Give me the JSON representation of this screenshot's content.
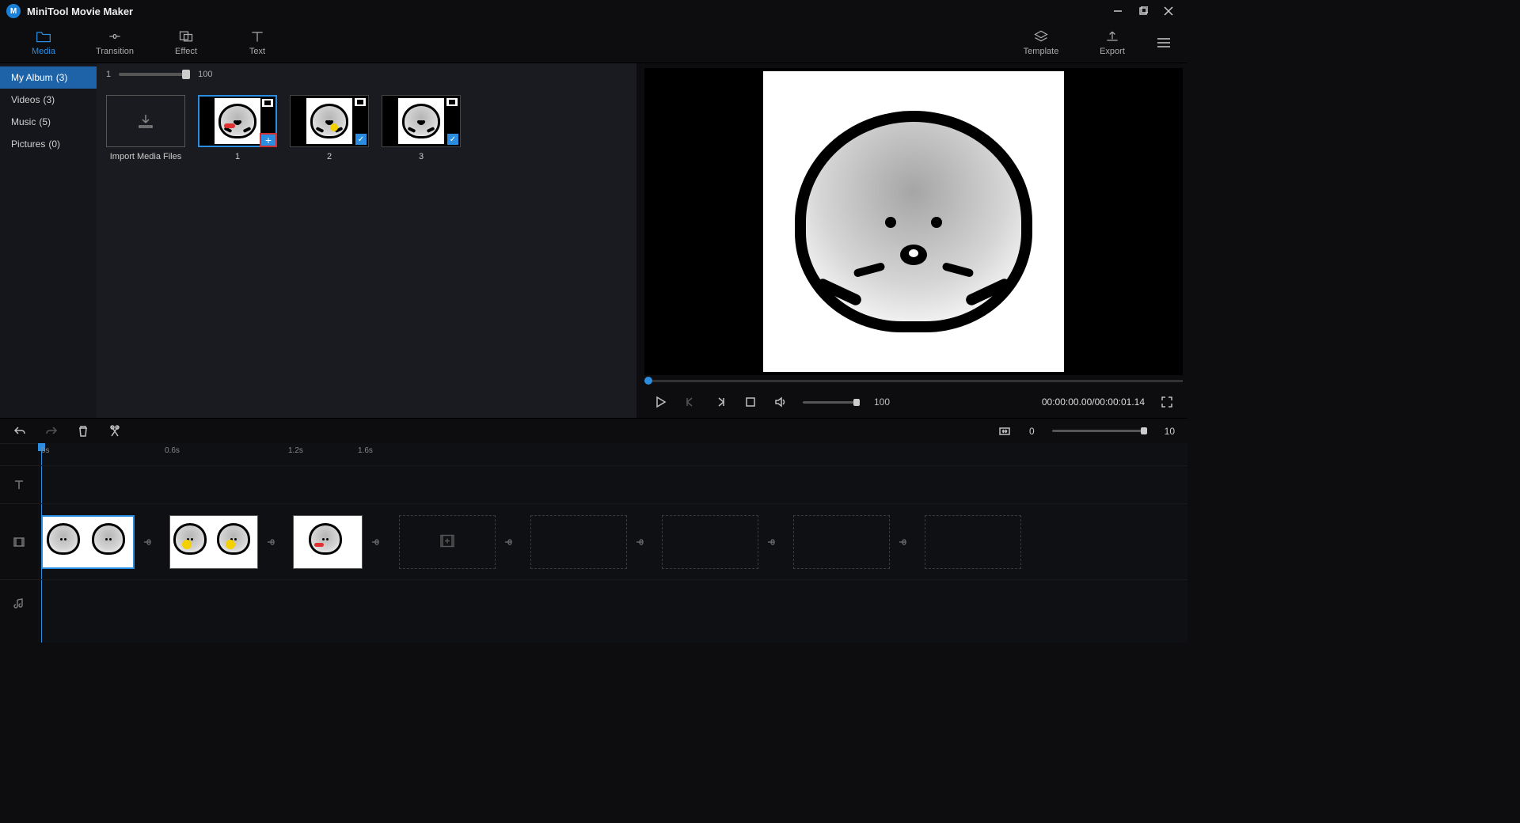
{
  "app": {
    "title": "MiniTool Movie Maker"
  },
  "toolbar": {
    "media": "Media",
    "transition": "Transition",
    "effect": "Effect",
    "text": "Text",
    "template": "Template",
    "export": "Export"
  },
  "sidebar": {
    "items": [
      {
        "label": "My Album",
        "count": "(3)",
        "active": true
      },
      {
        "label": "Videos",
        "count": "(3)"
      },
      {
        "label": "Music",
        "count": "(5)"
      },
      {
        "label": "Pictures",
        "count": "(0)"
      }
    ]
  },
  "mediaZoom": {
    "min": "1",
    "max": "100"
  },
  "mediaTiles": {
    "import": "Import Media Files",
    "items": [
      {
        "name": "1",
        "selected": true,
        "addHighlighted": true
      },
      {
        "name": "2",
        "checked": true
      },
      {
        "name": "3",
        "checked": true
      }
    ]
  },
  "preview": {
    "volume": "100",
    "timecode": "00:00:00.00/00:00:01.14"
  },
  "timelineToolbar": {
    "zoomMin": "0",
    "zoomMax": "10"
  },
  "ruler": {
    "ticks": [
      "0s",
      "0.6s",
      "1.2s",
      "1.6s"
    ]
  }
}
